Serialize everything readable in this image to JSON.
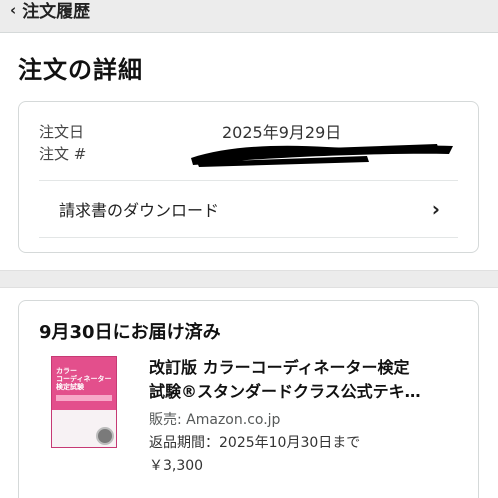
{
  "header": {
    "back_label": "注文履歴"
  },
  "page_title": "注文の詳細",
  "order_summary": {
    "date_label": "注文日",
    "date_value": "2025年9月29日",
    "number_label": "注文 #",
    "invoice_link": "請求書のダウンロード"
  },
  "shipment": {
    "status": "9月30日にお届け済み",
    "item": {
      "title_line1": "改訂版 カラーコーディネーター検定",
      "title_line2": "試験®スタンダードクラス公式テキ…",
      "seller": "販売: Amazon.co.jp",
      "return_window": "返品期間：2025年10月30日まで",
      "price": "￥3,300",
      "thumbnail_text": "カラー\nコーディネーター\n検定試験"
    }
  },
  "colors": {
    "accent": "#e34f8c",
    "text": "#0f1111",
    "muted": "#565959",
    "border": "#d5d9d9",
    "bg_gray": "#ececec"
  }
}
